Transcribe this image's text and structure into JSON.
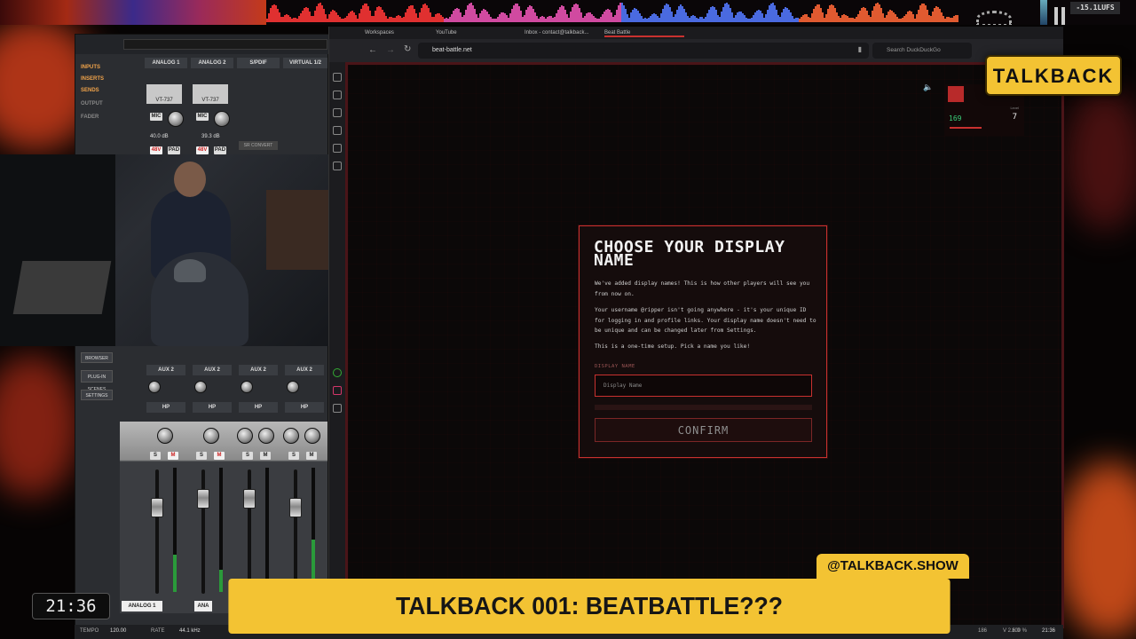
{
  "meters": {
    "loudness": "-15.1LUFS"
  },
  "browser": {
    "tabs": [
      "Workspaces",
      "YouTube",
      "Inbox - contact@talkback...",
      "Beat Battle"
    ],
    "url": "beat-battle.net",
    "search_placeholder": "Search DuckDuckGo"
  },
  "game_hud": {
    "score": "169",
    "level_label": "Level",
    "level": "7"
  },
  "modal": {
    "title": "CHOOSE YOUR DISPLAY NAME",
    "intro": "We've added display names! This is how other players will see you from now on.",
    "username_note": "Your username @ripper isn't going anywhere - it's your unique ID for logging in and profile links. Your display name doesn't need to be unique and can be changed later from Settings.",
    "setup_note": "This is a one-time setup. Pick a name you like!",
    "field_label": "DISPLAY NAME",
    "input_placeholder": "Display Name",
    "confirm_label": "CONFIRM"
  },
  "console": {
    "nav": [
      "INPUTS",
      "INSERTS",
      "SENDS",
      "OUTPUT",
      "FADER"
    ],
    "channels": [
      "ANALOG 1",
      "ANALOG 2",
      "S/PDIF",
      "VIRTUAL 1/2"
    ],
    "plugin": "VT-737",
    "mic_label": "MIC",
    "gains": [
      "40.0 dB",
      "39.3 dB"
    ],
    "phantom": "48V",
    "pad": "PAD",
    "sr_convert": "SR CONVERT",
    "side_buttons": [
      "BROWSER",
      "PLUG-IN SCENES",
      "SETTINGS"
    ],
    "aux": [
      "AUX 2",
      "AUX 2",
      "AUX 2",
      "AUX 2"
    ],
    "hp": "HP",
    "solo": "S",
    "mute": "M",
    "bottom_channel": "ANALOG 1",
    "bottom_channel_2": "ANA",
    "scale": [
      "6",
      "0",
      "-3",
      "-6",
      "-9",
      "-12",
      "-16",
      "-20",
      "-30",
      "-40",
      "-60"
    ]
  },
  "status_bar": {
    "tempo_label": "TEMPO",
    "tempo": "120.00",
    "rate_label": "RATE",
    "rate": "44.1 kHz",
    "version": "V 2.6.0",
    "zoom": "100 %",
    "time": "21:36",
    "count": "186"
  },
  "overlay": {
    "logo": "TALKBACK",
    "handle": "@TALKBACK.SHOW",
    "lower_third": "TALKBACK 001: BEATBATTLE???",
    "clock": "21:36"
  }
}
